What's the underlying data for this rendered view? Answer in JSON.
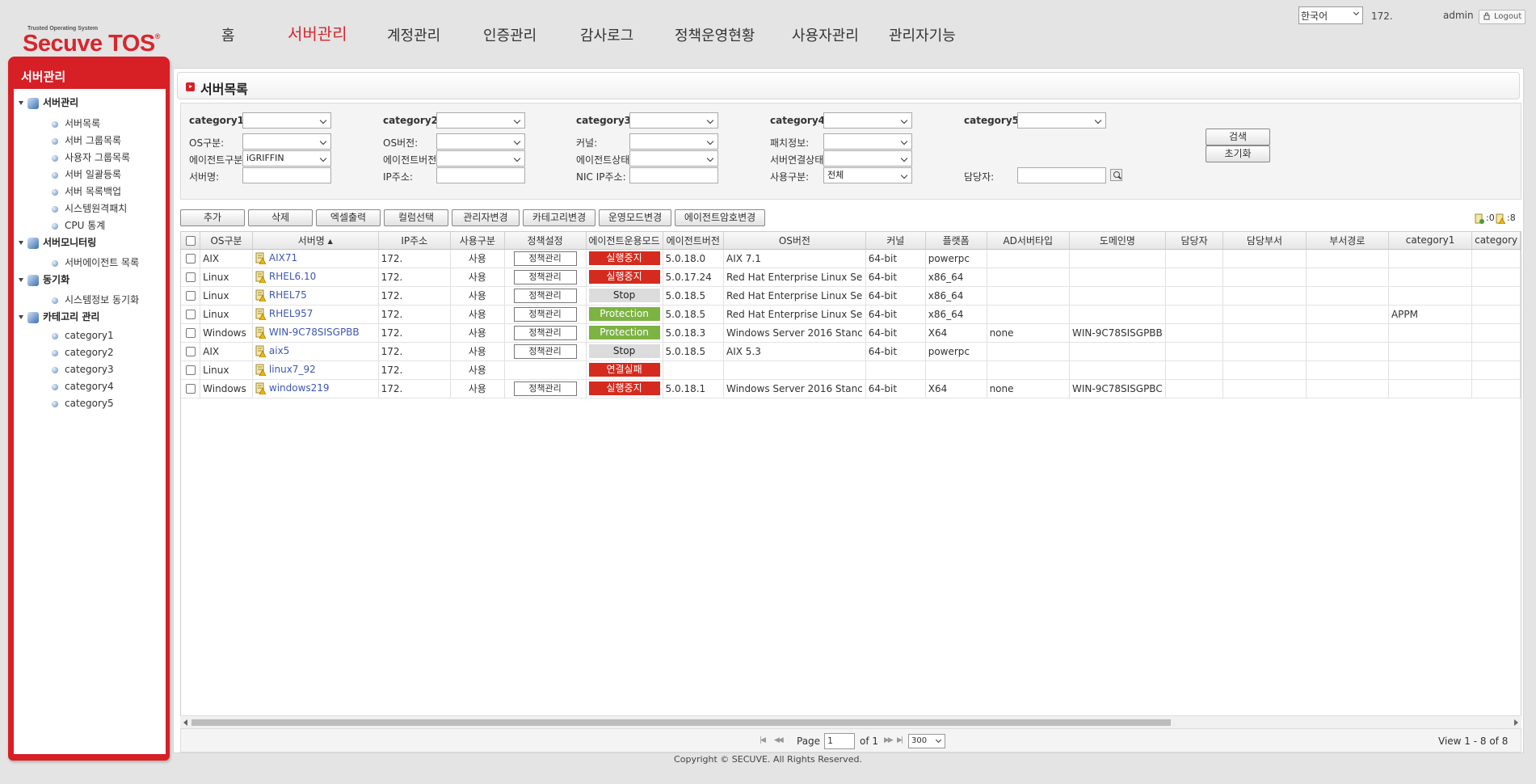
{
  "brand": {
    "tagline": "Trusted Operating System",
    "name": "Secuve TOS",
    "reg": "®"
  },
  "nav": [
    "홈",
    "서버관리",
    "계정관리",
    "인증관리",
    "감사로그",
    "정책운영현황",
    "사용자관리",
    "관리자기능"
  ],
  "nav_active": "서버관리",
  "header": {
    "language": "한국어",
    "ip": "172.",
    "user": "admin",
    "logout": "Logout"
  },
  "sidebar": {
    "title": "서버관리",
    "groups": [
      {
        "label": "서버관리",
        "items": [
          "서버목록",
          "서버 그룹목록",
          "사용자 그룹목록",
          "서버 일괄등록",
          "서버 목록백업",
          "시스템원격패치",
          "CPU 통계"
        ]
      },
      {
        "label": "서버모니터링",
        "items": [
          "서버에이전트 목록"
        ]
      },
      {
        "label": "동기화",
        "items": [
          "시스템정보 동기화"
        ]
      },
      {
        "label": "카테고리 관리",
        "items": [
          "category1",
          "category2",
          "category3",
          "category4",
          "category5"
        ]
      }
    ]
  },
  "page_title": "서버목록",
  "filters": {
    "category1": "category1:",
    "category2": "category2:",
    "category3": "category3:",
    "category4": "category4:",
    "category5": "category5:",
    "os_type": "OS구분:",
    "os_version": "OS버전:",
    "kernel": "커널:",
    "patch_info": "패치정보:",
    "agent_type": "에이전트구분:",
    "agent_type_value": "iGRIFFIN",
    "agent_version": "에이전트버전:",
    "agent_status": "에이전트상태:",
    "server_conn_status": "서버연결상태:",
    "server_name": "서버명:",
    "ip": "IP주소:",
    "nic_ip": "NIC IP주소:",
    "usage_type": "사용구분:",
    "usage_type_value": "전체",
    "manager": "담당자:",
    "search_btn": "검색",
    "reset_btn": "초기화"
  },
  "toolbar": [
    "추가",
    "삭제",
    "엑셀출력",
    "컬럼선택",
    "관리자변경",
    "카테고리변경",
    "운영모드변경",
    "에이전트암호변경"
  ],
  "counts": {
    "a": ":0",
    "b": ":8"
  },
  "table": {
    "columns": [
      "OS구분",
      "서버명",
      "IP주소",
      "사용구분",
      "정책설정",
      "에이전트운용모드",
      "에이전트버전",
      "OS버전",
      "커널",
      "플랫폼",
      "AD서버타입",
      "도메인명",
      "담당자",
      "담당부서",
      "부서경로",
      "category1",
      "category"
    ],
    "sort_column": "서버명",
    "policy_btn": "정책관리",
    "rows": [
      {
        "os": "AIX",
        "name": "AIX71",
        "ip": "172.",
        "usage": "사용",
        "policy": true,
        "mode": "실행중지",
        "mode_style": "red",
        "ver": "5.0.18.0",
        "osver": "AIX 7.1",
        "kernel": "64-bit",
        "platform": "powerpc",
        "ad": "",
        "domain": "",
        "cat1": ""
      },
      {
        "os": "Linux",
        "name": "RHEL6.10",
        "ip": "172.",
        "usage": "사용",
        "policy": true,
        "mode": "실행중지",
        "mode_style": "red",
        "ver": "5.0.17.24",
        "osver": "Red Hat Enterprise Linux Se",
        "kernel": "64-bit",
        "platform": "x86_64",
        "ad": "",
        "domain": "",
        "cat1": ""
      },
      {
        "os": "Linux",
        "name": "RHEL75",
        "ip": "172.",
        "usage": "사용",
        "policy": true,
        "mode": "Stop",
        "mode_style": "gray",
        "ver": "5.0.18.5",
        "osver": "Red Hat Enterprise Linux Se",
        "kernel": "64-bit",
        "platform": "x86_64",
        "ad": "",
        "domain": "",
        "cat1": ""
      },
      {
        "os": "Linux",
        "name": "RHEL957",
        "ip": "172.",
        "usage": "사용",
        "policy": true,
        "mode": "Protection",
        "mode_style": "green",
        "ver": "5.0.18.5",
        "osver": "Red Hat Enterprise Linux Se",
        "kernel": "64-bit",
        "platform": "x86_64",
        "ad": "",
        "domain": "",
        "cat1": "APPM"
      },
      {
        "os": "Windows",
        "name": "WIN-9C78SISGPBB",
        "ip": "172.",
        "usage": "사용",
        "policy": true,
        "mode": "Protection",
        "mode_style": "green",
        "ver": "5.0.18.3",
        "osver": "Windows Server 2016 Stanc",
        "kernel": "64-bit",
        "platform": "X64",
        "ad": "none",
        "domain": "WIN-9C78SISGPBB",
        "cat1": ""
      },
      {
        "os": "AIX",
        "name": "aix5",
        "ip": "172.",
        "usage": "사용",
        "policy": true,
        "mode": "Stop",
        "mode_style": "gray",
        "ver": "5.0.18.5",
        "osver": "AIX 5.3",
        "kernel": "64-bit",
        "platform": "powerpc",
        "ad": "",
        "domain": "",
        "cat1": ""
      },
      {
        "os": "Linux",
        "name": "linux7_92",
        "ip": "172.",
        "usage": "사용",
        "policy": false,
        "mode": "연결실패",
        "mode_style": "red",
        "ver": "",
        "osver": "",
        "kernel": "",
        "platform": "",
        "ad": "",
        "domain": "",
        "cat1": ""
      },
      {
        "os": "Windows",
        "name": "windows219",
        "ip": "172.",
        "usage": "사용",
        "policy": true,
        "mode": "실행중지",
        "mode_style": "red",
        "ver": "5.0.18.1",
        "osver": "Windows Server 2016 Stanc",
        "kernel": "64-bit",
        "platform": "X64",
        "ad": "none",
        "domain": "WIN-9C78SISGPBC",
        "cat1": ""
      }
    ]
  },
  "pager": {
    "page_label": "Page",
    "page": "1",
    "of": "of 1",
    "page_size": "300",
    "view": "View 1 - 8 of 8"
  },
  "footer": "Copyright © SECUVE. All Rights Reserved."
}
